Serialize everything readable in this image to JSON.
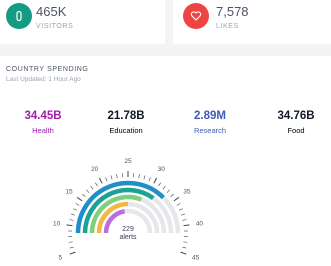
{
  "stats": [
    {
      "value": "465K",
      "label": "VISITORS",
      "icon": "toggle-icon",
      "color": "#159b84"
    },
    {
      "value": "7,578",
      "label": "LIKES",
      "icon": "heart-icon",
      "color": "#ef4444"
    }
  ],
  "spending": {
    "title": "COUNTRY SPENDING",
    "updated": "Last Updated: 1 Hour Ago",
    "metrics": [
      {
        "value": "34.45B",
        "label": "Health",
        "color": "#a21caf"
      },
      {
        "value": "21.78B",
        "label": "Education",
        "color": "#111827"
      },
      {
        "value": "2.89M",
        "label": "Research",
        "color": "#3f5bb5"
      },
      {
        "value": "34.76B",
        "label": "Food",
        "color": "#111827"
      }
    ]
  },
  "gauge": {
    "ticks": [
      "5",
      "10",
      "15",
      "20",
      "25",
      "30",
      "35",
      "40",
      "45"
    ],
    "center_value": "229",
    "center_label": "alerts",
    "rings": [
      {
        "color": "#1f8fc9",
        "level": 0.75
      },
      {
        "color": "#1aa392",
        "level": 0.7
      },
      {
        "color": "#7fd07a",
        "level": 0.62
      },
      {
        "color": "#f2b845",
        "level": 0.5
      },
      {
        "color": "#b96ee0",
        "level": 0.45
      }
    ],
    "track_color": "#e5e7eb"
  }
}
